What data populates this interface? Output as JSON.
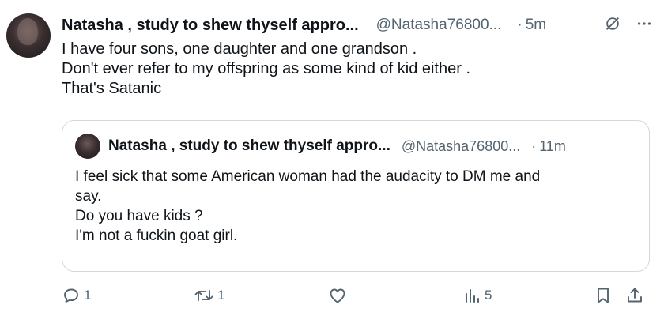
{
  "post": {
    "author_name": "Natasha , study to shew thyself appro...",
    "handle": "@Natasha76800...",
    "separator": "·",
    "time": "5m",
    "lines": [
      "I have four sons, one daughter and one grandson .",
      "Don't ever refer to my offspring as some kind of kid either .",
      "That's Satanic"
    ]
  },
  "quoted": {
    "author_name": "Natasha , study to shew thyself appro...",
    "handle": "@Natasha76800...",
    "separator": "·",
    "time": "11m",
    "lines": [
      "I feel sick that some American woman had the audacity to DM me and",
      "say.",
      "Do you have kids  ?",
      "I'm not a fuckin goat girl."
    ]
  },
  "actions": {
    "replies": "1",
    "reposts": "1",
    "likes": "",
    "views": "5"
  },
  "icons": [
    "reply-icon",
    "repost-icon",
    "like-icon",
    "views-icon",
    "bookmark-icon",
    "share-icon",
    "grok-icon",
    "more-icon"
  ],
  "colors": {
    "text": "#0f1419",
    "secondary": "#536471",
    "border": "#cfd9de"
  }
}
